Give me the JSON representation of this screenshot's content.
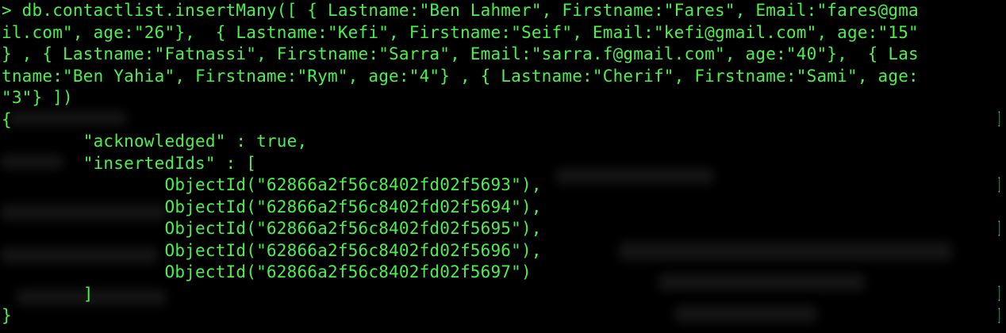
{
  "terminal": {
    "colors": {
      "background": "#000000",
      "text": "#4cf04c"
    },
    "lines": [
      "> db.contactlist.insertMany([ { Lastname:\"Ben Lahmer\", Firstname:\"Fares\", Email:\"fares@gma",
      "il.com\", age:\"26\"},  { Lastname:\"Kefi\", Firstname:\"Seif\", Email:\"kefi@gmail.com\", age:\"15\"",
      "} , { Lastname:\"Fatnassi\", Firstname:\"Sarra\", Email:\"sarra.f@gmail.com\", age:\"40\"},  { Las",
      "tname:\"Ben Yahia\", Firstname:\"Rym\", age:\"4\"} , { Lastname:\"Cherif\", Firstname:\"Sami\", age:",
      "\"3\"} ])",
      "{",
      "        \"acknowledged\" : true,",
      "        \"insertedIds\" : [",
      "                ObjectId(\"62866a2f56c8402fd02f5693\"),",
      "                ObjectId(\"62866a2f56c8402fd02f5694\"),",
      "                ObjectId(\"62866a2f56c8402fd02f5695\"),",
      "                ObjectId(\"62866a2f56c8402fd02f5696\"),",
      "                ObjectId(\"62866a2f56c8402fd02f5697\")",
      "        ]",
      "}"
    ]
  }
}
